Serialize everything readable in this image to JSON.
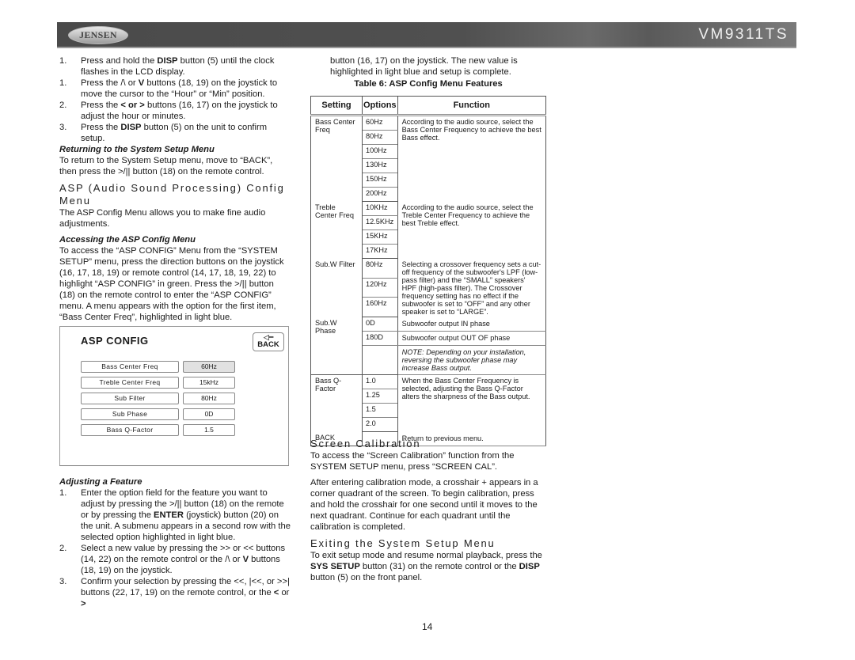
{
  "header": {
    "brand": "JENSEN",
    "model": "VM9311TS"
  },
  "left": {
    "steps1": [
      {
        "n": "1.",
        "pre": "Press and hold the ",
        "bold": "DISP",
        "post": " button (5) until the clock flashes in the LCD display."
      },
      {
        "n": "1.",
        "pre": "Press the /\\ or ",
        "bold": "V",
        "post": " buttons (18, 19) on the joystick to move the cursor to the “Hour” or “Min” position."
      },
      {
        "n": "2.",
        "pre": "Press the ",
        "bold": "< or >",
        "post": " buttons (16, 17) on the joystick to adjust the hour or minutes."
      },
      {
        "n": "3.",
        "pre": "Press the ",
        "bold": "DISP",
        "post": " button (5) on the unit to confirm setup."
      }
    ],
    "returning_heading": "Returning to the System Setup Menu",
    "returning_text": "To return to the System Setup menu, move to “BACK”, then press the >/|| button (18) on the remote control.",
    "asp_heading": "ASP (Audio Sound Processing) Config Menu",
    "asp_text": "The ASP Config Menu allows you to make fine audio adjustments.",
    "accessing_heading": "Accessing the ASP Config Menu",
    "accessing_text": "To access the “ASP CONFIG” Menu from the “SYSTEM SETUP” menu, press the direction buttons on the joystick (16, 17, 18, 19) or remote control (14, 17, 18, 19, 22) to highlight “ASP CONFIG” in green. Press the >/|| button (18) on the remote control to enter the “ASP CONFIG” menu. A menu appears with the option for the first item, “Bass Center Freq”, highlighted in light blue.",
    "adjusting_heading": "Adjusting a Feature",
    "steps2": [
      {
        "n": "1.",
        "html": "Enter the option field for the feature you want to adjust by pressing the >/|| button (18) on the remote or by pressing the <b>ENTER</b> (joystick) button (20) on the unit. A submenu appears in a second row with the selected option highlighted in light blue."
      },
      {
        "n": "2.",
        "html": "Select a new value by pressing the >> or << buttons (14, 22) on the remote control or the /\\ or <b>V</b> buttons (18, 19) on the joystick."
      },
      {
        "n": "3.",
        "html": "Confirm your selection by pressing the <<, |<<, or >>| buttons (22, 17, 19) on the remote control, or the <b>&lt;</b> or <b>&gt;</b>"
      }
    ]
  },
  "asp_panel": {
    "title": "ASP CONFIG",
    "back_label": "BACK",
    "back_arrow": "◁━",
    "rows": [
      {
        "label": "Bass Center Freq",
        "value": "60Hz",
        "selected": true
      },
      {
        "label": "Treble Center Freq",
        "value": "15kHz",
        "selected": false
      },
      {
        "label": "Sub Filter",
        "value": "80Hz",
        "selected": false
      },
      {
        "label": "Sub Phase",
        "value": "0D",
        "selected": false
      },
      {
        "label": "Bass Q-Factor",
        "value": "1.5",
        "selected": false
      }
    ]
  },
  "right": {
    "continued_text": "button (16, 17) on the joystick. The new value is highlighted in light blue and setup is complete.",
    "table_caption": "Table 6: ASP Config Menu Features",
    "table_headers": [
      "Setting",
      "Options",
      "Function"
    ],
    "table_groups": [
      {
        "setting": "Bass Center Freq",
        "options": [
          "60Hz",
          "80Hz",
          "100Hz",
          "130Hz",
          "150Hz",
          "200Hz"
        ],
        "function": "According to the audio source, select the Bass Center Frequency to achieve the best Bass effect."
      },
      {
        "setting": "Treble Center Freq",
        "options": [
          "10KHz",
          "12.5KHz",
          "15KHz",
          "17KHz"
        ],
        "function": "According to the audio source, select the Treble Center Frequency to achieve the best Treble effect."
      },
      {
        "setting": "Sub.W Filter",
        "options": [
          "80Hz",
          "120Hz",
          "160Hz"
        ],
        "function": "Selecting a crossover frequency sets a cut-off frequency of the subwoofer's LPF (low-pass filter) and the “SMALL” speakers' HPF (high-pass filter). The Crossover frequency setting has no effect if the subwoofer is set to “OFF” and any other speaker is set to “LARGE”."
      },
      {
        "setting": "Sub.W Phase",
        "rows": [
          {
            "option": "0D",
            "function": "Subwoofer output IN phase"
          },
          {
            "option": "180D",
            "function": "Subwoofer output OUT OF phase"
          },
          {
            "option": "",
            "function": "NOTE: Depending on your installation, reversing the subwoofer phase may increase Bass output.",
            "note": true
          }
        ]
      },
      {
        "setting": "Bass Q-Factor",
        "options": [
          "1.0",
          "1.25",
          "1.5",
          "2.0"
        ],
        "function": "When the Bass Center Frequency is selected, adjusting the Bass Q-Factor alters the sharpness of the Bass output."
      },
      {
        "setting": "BACK",
        "rows": [
          {
            "option": "",
            "function": "Return to previous menu."
          }
        ]
      }
    ],
    "screen_cal_heading": "Screen Calibration",
    "screen_cal_text1": "To access the “Screen Calibration” function from the SYSTEM SETUP menu, press “SCREEN CAL”.",
    "screen_cal_text2": "After entering calibration mode, a crosshair + appears in a corner quadrant of the screen. To begin calibration, press and hold the crosshair for one second until it moves to the next quadrant. Continue for each quadrant until the calibration is completed.",
    "exit_heading": "Exiting the System Setup Menu",
    "exit_text_html": "To exit setup mode and resume normal playback, press the <b>SYS SETUP</b> button (31) on the remote control or the <b>DISP</b> button (5) on the front panel."
  },
  "page_number": "14"
}
